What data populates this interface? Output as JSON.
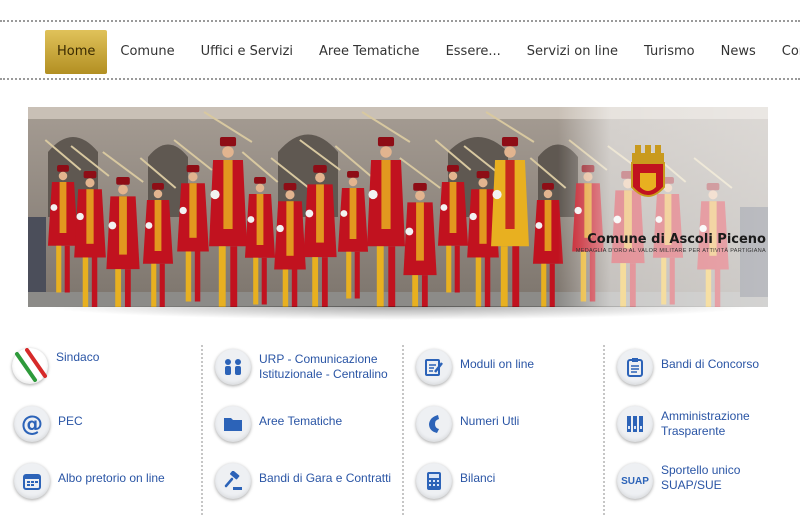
{
  "nav": {
    "items": [
      {
        "label": "Home",
        "active": true
      },
      {
        "label": "Comune"
      },
      {
        "label": "Uffici e Servizi"
      },
      {
        "label": "Aree Tematiche"
      },
      {
        "label": "Essere..."
      },
      {
        "label": "Servizi on line"
      },
      {
        "label": "Turismo"
      },
      {
        "label": "News"
      },
      {
        "label": "Contatti"
      }
    ]
  },
  "banner": {
    "brand_name": "Comune di Ascoli Piceno",
    "brand_sub": "MEDAGLIA D'ORO AL VALOR MILITARE PER ATTIVITÀ PARTIGIANA"
  },
  "quick_links": {
    "col1": [
      {
        "label": "Sindaco",
        "icon": "flag-icon"
      },
      {
        "label": "PEC",
        "icon": "at-icon"
      },
      {
        "label": "Albo pretorio on line",
        "icon": "calendar-icon"
      }
    ],
    "col2": [
      {
        "label": "URP - Comunicazione Istituzionale - Centralino",
        "line1": "URP - Comunicazione",
        "line2": "Istituzionale - Centralino",
        "icon": "people-icon"
      },
      {
        "label": "Aree Tematiche",
        "icon": "folder-icon"
      },
      {
        "label": "Bandi di Gara e Contratti",
        "icon": "gavel-icon"
      }
    ],
    "col3": [
      {
        "label": "Moduli on line",
        "icon": "form-icon"
      },
      {
        "label": "Numeri Utli",
        "icon": "phone-icon"
      },
      {
        "label": "Bilanci",
        "icon": "calculator-icon"
      }
    ],
    "col4": [
      {
        "label": "Bandi di Concorso",
        "icon": "clipboard-icon"
      },
      {
        "label": "Amministrazione Trasparente",
        "line1": "Amministrazione",
        "line2": "Trasparente",
        "icon": "binders-icon"
      },
      {
        "label": "Sportello unico SUAP/SUE",
        "icon": "suap-icon",
        "icon_text": "SUAP"
      }
    ]
  },
  "colors": {
    "nav_active": "#c9a73a",
    "link": "#2a55a5",
    "icon": "#2c63b8",
    "costume_red": "#c1121f",
    "costume_yellow": "#e8b020"
  }
}
